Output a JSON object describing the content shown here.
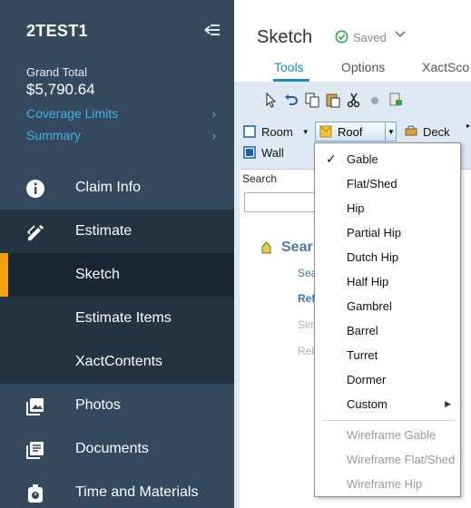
{
  "sidebar": {
    "title": "2TEST1",
    "grand_total_label": "Grand Total",
    "grand_total": "$5,790.64",
    "links": [
      {
        "label": "Coverage Limits",
        "chevron": "›"
      },
      {
        "label": "Summary",
        "chevron": "›"
      }
    ],
    "nav": [
      {
        "label": "Claim Info",
        "icon": "info-icon"
      },
      {
        "label": "Estimate",
        "icon": "pencil-icon"
      },
      {
        "label": "Photos",
        "icon": "photos-icon"
      },
      {
        "label": "Documents",
        "icon": "documents-icon"
      },
      {
        "label": "Time and Materials",
        "icon": "timer-icon"
      }
    ],
    "estimate_sub": [
      {
        "label": "Sketch",
        "active": true
      },
      {
        "label": "Estimate Items",
        "active": false
      },
      {
        "label": "XactContents",
        "active": false
      }
    ],
    "accent_color": "#f0a30a"
  },
  "main": {
    "title": "Sketch",
    "saved_label": "Saved",
    "tabs": [
      {
        "label": "Tools",
        "active": true
      },
      {
        "label": "Options",
        "active": false
      },
      {
        "label": "XactSco",
        "active": false
      }
    ],
    "ribbon": {
      "room": "Room",
      "roof": "Roof",
      "deck": "Deck",
      "wall": "Wall"
    },
    "panel": {
      "search_label": "Search",
      "heading": "Sear",
      "rows": [
        "Sea",
        "Ref",
        "Sim",
        "Rela"
      ]
    }
  },
  "roof_menu": {
    "items": [
      "Gable",
      "Flat/Shed",
      "Hip",
      "Partial Hip",
      "Dutch Hip",
      "Half Hip",
      "Gambrel",
      "Barrel",
      "Turret",
      "Dormer",
      "Custom"
    ],
    "checked": "Gable",
    "wireframe_items": [
      "Wireframe Gable",
      "Wireframe Flat/Shed",
      "Wireframe Hip"
    ]
  }
}
